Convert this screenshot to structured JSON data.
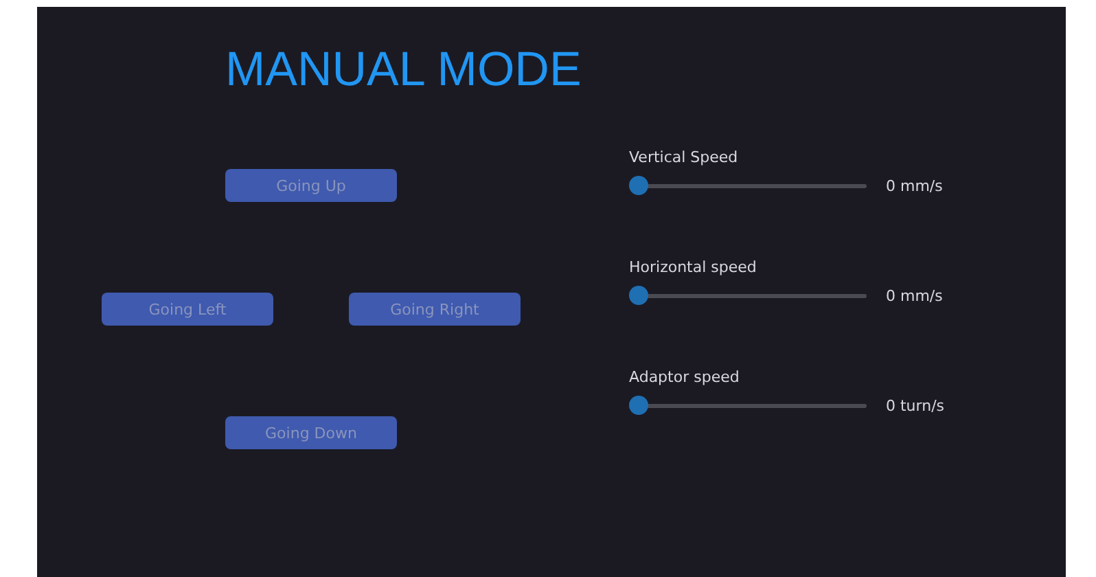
{
  "title": "MANUAL MODE",
  "buttons": [
    {
      "label": "Going Up",
      "disabled": true,
      "kind": "up"
    },
    {
      "label": "Going Left",
      "disabled": true,
      "kind": "left"
    },
    {
      "label": "Going Right",
      "disabled": true,
      "kind": "right"
    },
    {
      "label": "Going Down",
      "disabled": true,
      "kind": "down"
    }
  ],
  "sliders": [
    {
      "label": "Vertical Speed",
      "level": 0,
      "reading": "0 mm/s"
    },
    {
      "label": "Horizontal speed",
      "level": 0,
      "reading": "0 mm/s"
    },
    {
      "label": "Adaptor speed",
      "level": 0,
      "reading": "0 turn/s"
    }
  ]
}
